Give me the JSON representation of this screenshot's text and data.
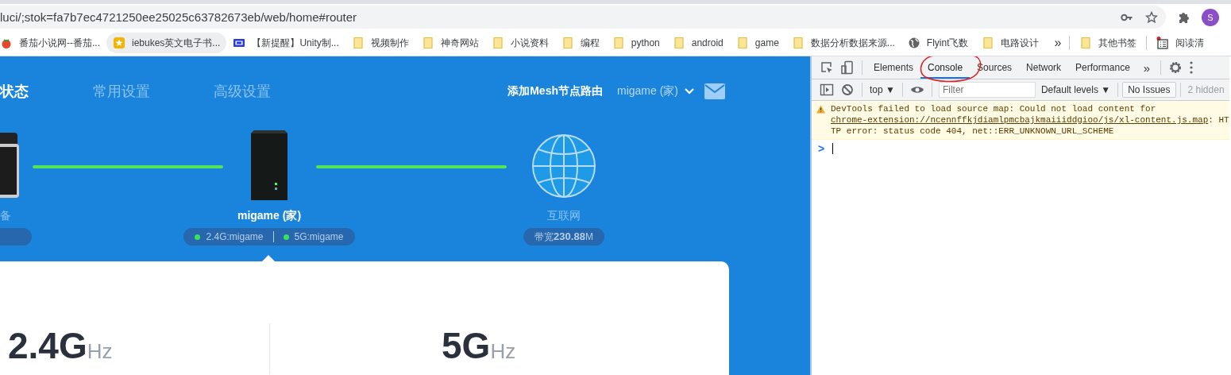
{
  "browser": {
    "url": "luci/;stok=fa7b7ec4721250ee25025c63782673eb/web/home#router",
    "avatar": "S",
    "bookmarks": [
      {
        "label": "番茄小说网--番茄...",
        "kind": "tomato",
        "highlighted": false
      },
      {
        "label": "iebukes英文电子书...",
        "kind": "star",
        "highlighted": true
      },
      {
        "label": "【新提醒】Unity制...",
        "kind": "site",
        "highlighted": false
      },
      {
        "label": "视频制作",
        "kind": "folder",
        "highlighted": false
      },
      {
        "label": "神奇网站",
        "kind": "folder",
        "highlighted": false
      },
      {
        "label": "小说资料",
        "kind": "folder",
        "highlighted": false
      },
      {
        "label": "编程",
        "kind": "folder",
        "highlighted": false
      },
      {
        "label": "python",
        "kind": "folder",
        "highlighted": false
      },
      {
        "label": "android",
        "kind": "folder",
        "highlighted": false
      },
      {
        "label": "game",
        "kind": "folder",
        "highlighted": false
      },
      {
        "label": "数据分析数据来源...",
        "kind": "folder",
        "highlighted": false
      },
      {
        "label": "Flyint飞数",
        "kind": "globe",
        "highlighted": false
      },
      {
        "label": "电路设计",
        "kind": "folder",
        "highlighted": false
      }
    ],
    "more": "»",
    "other_bookmarks": "其他书签",
    "reading_list": "阅读清"
  },
  "router_page": {
    "nav_tabs": [
      {
        "label": "状态",
        "selected": true
      },
      {
        "label": "常用设置",
        "selected": false
      },
      {
        "label": "高级设置",
        "selected": false
      }
    ],
    "mesh_link": "添加Mesh节点路由",
    "account": "migame (家)",
    "nodes": [
      {
        "kind": "phone",
        "label": "备"
      },
      {
        "kind": "router",
        "label": "migame (家)",
        "pill": [
          {
            "text": "2.4G:migame",
            "connected": true
          },
          {
            "text": "5G:migame",
            "connected": true
          }
        ]
      },
      {
        "kind": "globe",
        "label": "互联网",
        "pill": [
          {
            "text": "带宽**230.88**M"
          }
        ]
      }
    ],
    "links": [
      {
        "connected": true
      },
      {
        "connected": true
      }
    ],
    "bands": [
      {
        "value": "2.4G",
        "unit": "Hz"
      },
      {
        "value": "5G",
        "unit": "Hz"
      }
    ]
  },
  "devtools": {
    "tabs": [
      {
        "label": "Elements",
        "selected": false
      },
      {
        "label": "Console",
        "selected": true
      },
      {
        "label": "Sources",
        "selected": false
      },
      {
        "label": "Network",
        "selected": false
      },
      {
        "label": "Performance",
        "selected": false
      }
    ],
    "more_tabs": "»",
    "context": "top ▼",
    "filter_placeholder": "Filter",
    "levels": "Default levels ▼",
    "issues": "No Issues",
    "hidden": "2 hidden",
    "messages": [
      {
        "kind": "warning",
        "before": "DevTools failed to load source map: Could not load content for ",
        "link": "chrome-extension://ncennffkjdiamlpmcbajkmaiiiddgioo/js/xl-content.js.map",
        "after": ": HTTP error: status code 404, net::ERR_UNKNOWN_URL_SCHEME"
      }
    ],
    "prompt": ">"
  }
}
